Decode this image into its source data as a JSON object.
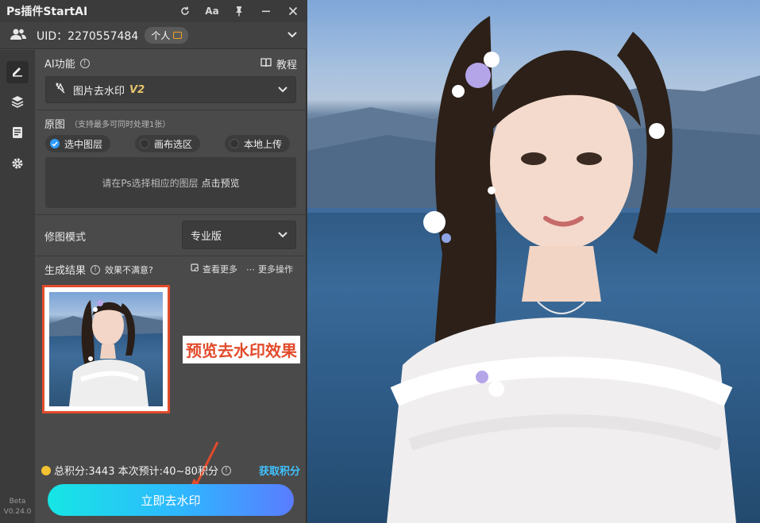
{
  "titlebar": {
    "title": "Ps插件StartAI"
  },
  "user": {
    "uid": "UID：2270557484",
    "badge": "个人"
  },
  "ai_function": {
    "label": "AI功能",
    "tutorial": "教程",
    "selected": "图片去水印",
    "version_tag": "V2"
  },
  "source": {
    "label": "原图",
    "hint": "（支持最多可同时处理1张）",
    "options": [
      "选中图层",
      "画布选区",
      "本地上传"
    ],
    "selected_index": 0,
    "preview_text": "请在Ps选择相应的图层",
    "preview_link": "点击预览"
  },
  "retouch": {
    "label": "修图模式",
    "value": "专业版"
  },
  "result": {
    "label": "生成结果",
    "unsatisfied": "效果不满意?",
    "view_more": "查看更多",
    "more_actions": "更多操作"
  },
  "callout": "预览去水印效果",
  "points": {
    "text": "总积分:3443 本次预计:40~80积分",
    "get": "获取积分"
  },
  "action_button": "立即去水印",
  "version": {
    "line1": "Beta",
    "line2": "V0.24.0"
  },
  "colors": {
    "accent": "#2e9bff",
    "callout_red": "#e24b2b",
    "button_start": "#16e6e4",
    "button_end": "#5a7cff",
    "link": "#3fc3ff"
  }
}
